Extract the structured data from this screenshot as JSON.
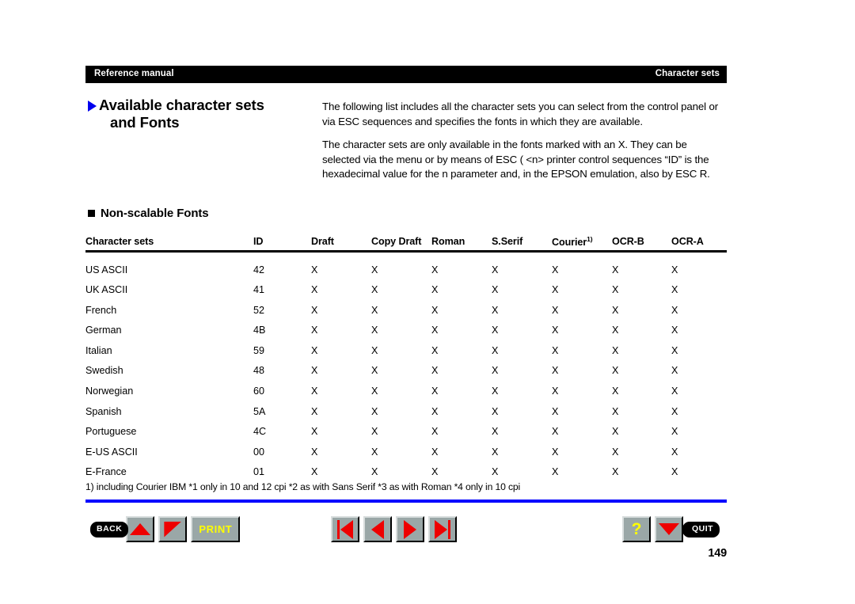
{
  "header": {
    "left_text": "Reference manual",
    "right_text": "Character sets"
  },
  "title": {
    "line1": "Available character sets",
    "line2": "and Fonts",
    "bullet_icon": "blue-triangle-right-icon",
    "bullet_color": "#0000ee"
  },
  "intro": {
    "paragraph1": "The following list includes all the character sets you can select from the control panel or via ESC sequences and specifies the fonts in which they are available.",
    "paragraph2": "The character sets are only available in the fonts marked with an X. They can be selected via the menu or by means of ESC ( <n> printer control sequences “ID” is the hexadecimal value for the n parameter and, in the EPSON emulation, also by ESC R."
  },
  "section": {
    "heading": "Non-scalable Fonts",
    "bullet_icon": "black-square-bullet-icon"
  },
  "table": {
    "columns": [
      "Character sets",
      "ID",
      "Draft",
      "Copy Draft",
      "Roman",
      "S.Serif",
      "Courier",
      "OCR-B",
      "OCR-A"
    ],
    "courier_superscript": "1)",
    "rows": [
      {
        "name": "US ASCII",
        "id": "42",
        "draft": "X",
        "copy_draft": "X",
        "roman": "X",
        "sserif": "X",
        "courier": "X",
        "ocr_b": "X",
        "ocr_a": "X"
      },
      {
        "name": "UK ASCII",
        "id": "41",
        "draft": "X",
        "copy_draft": "X",
        "roman": "X",
        "sserif": "X",
        "courier": "X",
        "ocr_b": "X",
        "ocr_a": "X"
      },
      {
        "name": "French",
        "id": "52",
        "draft": "X",
        "copy_draft": "X",
        "roman": "X",
        "sserif": "X",
        "courier": "X",
        "ocr_b": "X",
        "ocr_a": "X"
      },
      {
        "name": "German",
        "id": "4B",
        "draft": "X",
        "copy_draft": "X",
        "roman": "X",
        "sserif": "X",
        "courier": "X",
        "ocr_b": "X",
        "ocr_a": "X"
      },
      {
        "name": "Italian",
        "id": "59",
        "draft": "X",
        "copy_draft": "X",
        "roman": "X",
        "sserif": "X",
        "courier": "X",
        "ocr_b": "X",
        "ocr_a": "X"
      },
      {
        "name": "Swedish",
        "id": "48",
        "draft": "X",
        "copy_draft": "X",
        "roman": "X",
        "sserif": "X",
        "courier": "X",
        "ocr_b": "X",
        "ocr_a": "X"
      },
      {
        "name": "Norwegian",
        "id": "60",
        "draft": "X",
        "copy_draft": "X",
        "roman": "X",
        "sserif": "X",
        "courier": "X",
        "ocr_b": "X",
        "ocr_a": "X"
      },
      {
        "name": "Spanish",
        "id": "5A",
        "draft": "X",
        "copy_draft": "X",
        "roman": "X",
        "sserif": "X",
        "courier": "X",
        "ocr_b": "X",
        "ocr_a": "X"
      },
      {
        "name": "Portuguese",
        "id": "4C",
        "draft": "X",
        "copy_draft": "X",
        "roman": "X",
        "sserif": "X",
        "courier": "X",
        "ocr_b": "X",
        "ocr_a": "X"
      },
      {
        "name": "E-US ASCII",
        "id": "00",
        "draft": "X",
        "copy_draft": "X",
        "roman": "X",
        "sserif": "X",
        "courier": "X",
        "ocr_b": "X",
        "ocr_a": "X"
      },
      {
        "name": "E-France",
        "id": "01",
        "draft": "X",
        "copy_draft": "X",
        "roman": "X",
        "sserif": "X",
        "courier": "X",
        "ocr_b": "X",
        "ocr_a": "X"
      }
    ]
  },
  "footnote": "1) including Courier IBM  *1 only in 10 and 12 cpi  *2 as with Sans Serif  *3 as with Roman  *4 only in 10 cpi",
  "toolbar": {
    "back_label": "BACK",
    "quit_label": "QUIT",
    "print_label": "PRINT",
    "help_label": "?",
    "icons": {
      "scroll_up": "triangle-up-icon",
      "page_down": "corner-wedge-icon",
      "first_page": "skip-to-first-icon",
      "previous_page": "triangle-left-icon",
      "next_page": "triangle-right-icon",
      "last_page": "skip-to-last-icon",
      "quit_arrow": "triangle-down-icon"
    },
    "accent_red": "#ee0000",
    "accent_yellow": "#ffff00",
    "button_face": "#9aa7a7"
  },
  "page_number": "149",
  "rule_color": "#0000ff"
}
